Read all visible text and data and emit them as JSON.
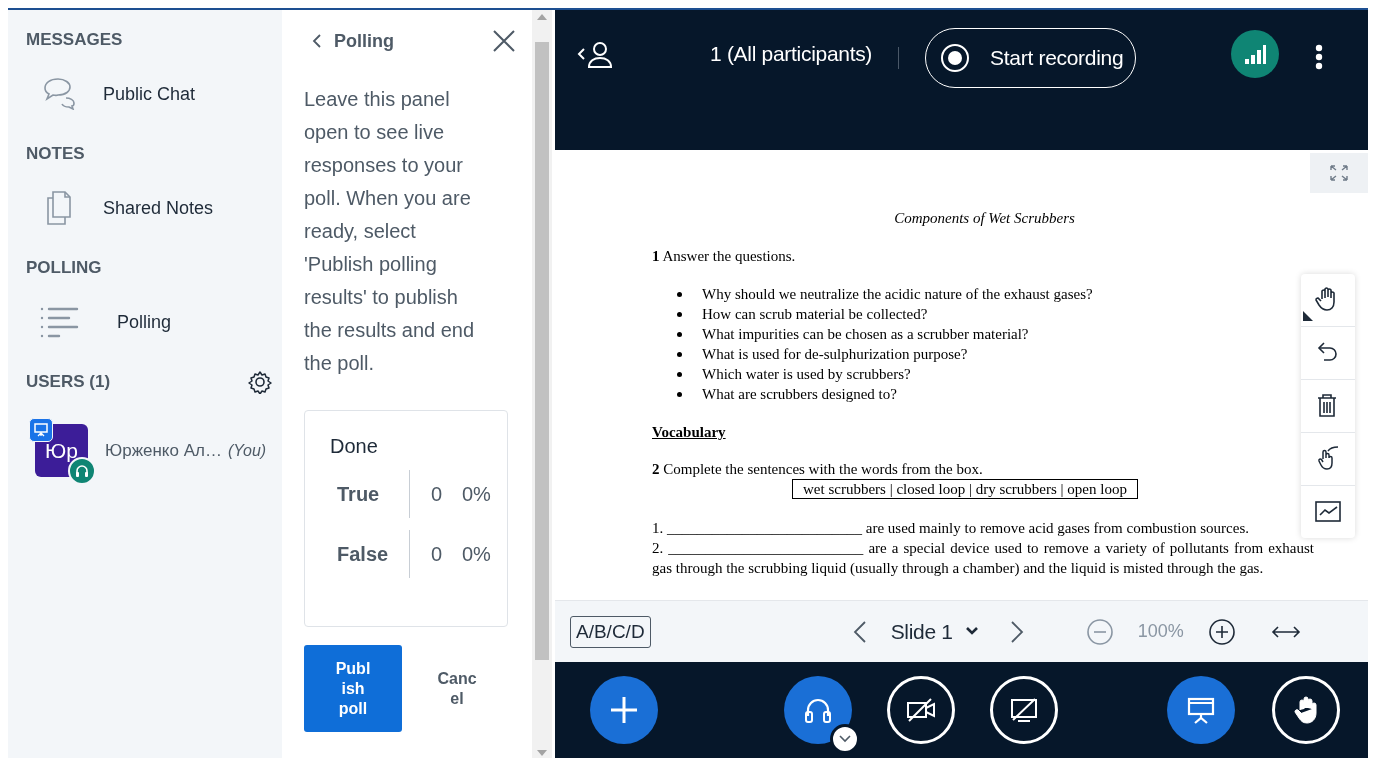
{
  "sidebar": {
    "sections": [
      {
        "title": "MESSAGES",
        "items": [
          {
            "label": "Public Chat",
            "kind": "chat"
          }
        ]
      },
      {
        "title": "NOTES",
        "items": [
          {
            "label": "Shared Notes",
            "kind": "notes"
          }
        ]
      },
      {
        "title": "POLLING",
        "items": [
          {
            "label": "Polling",
            "kind": "polling"
          }
        ]
      }
    ]
  },
  "users": {
    "title": "USERS (1)",
    "list": [
      {
        "initials": "Юр",
        "name": "Юрженко Ал…",
        "you_label": "(You)",
        "presenter": true,
        "audio": true
      }
    ]
  },
  "poll_panel": {
    "title": "Polling",
    "instructions": "Leave this panel open to see live responses to your poll. When you are ready, select 'Publish polling results' to publish the results and end the poll.",
    "status": "Done",
    "answers": [
      {
        "label": "True",
        "count": "0",
        "percent": "0%"
      },
      {
        "label": "False",
        "count": "0",
        "percent": "0%"
      }
    ],
    "buttons": [
      {
        "label": "Publish poll",
        "kind": "primary"
      },
      {
        "label": "Cancel",
        "kind": "plain"
      }
    ]
  },
  "top_bar": {
    "participants": "1 (All participants)",
    "record_button": "Start recording"
  },
  "presentation": {
    "title": "Components of Wet Scrubbers",
    "task_1": "**1** Answer the questions.",
    "questions": [
      "Why should we neutralize the acidic nature of the exhaust gases?",
      "How can scrub material be collected?",
      "What impurities can be chosen as a scrubber material?",
      "What is used for de-sulphurization purpose?",
      "Which water is used by scrubbers?",
      "What are scrubbers designed to?"
    ],
    "vocabulary_heading": "Vocabulary",
    "task_2": "**2** Complete the sentences with the words from the box.",
    "word_box": "wet scrubbers | closed loop | dry scrubbers | open loop",
    "sentences": [
      "1. __________________________ are used mainly to remove acid gases from combustion sources.",
      "2. __________________________ are a special device used to remove a variety of pollutants from exhaust gas through the scrubbing liquid (usually through a chamber) and the liquid is misted through the gas."
    ]
  },
  "slide_toolbar": {
    "quick_poll": "A/B/C/D",
    "slide": "Slide 1",
    "zoom": "100%"
  },
  "actions": [
    {
      "kind": "add",
      "active": true
    },
    {
      "kind": "audio",
      "active": true
    },
    {
      "kind": "video",
      "active": false
    },
    {
      "kind": "screen",
      "active": false
    },
    {
      "kind": "presentation",
      "active": true
    },
    {
      "kind": "hand",
      "active": false
    }
  ]
}
